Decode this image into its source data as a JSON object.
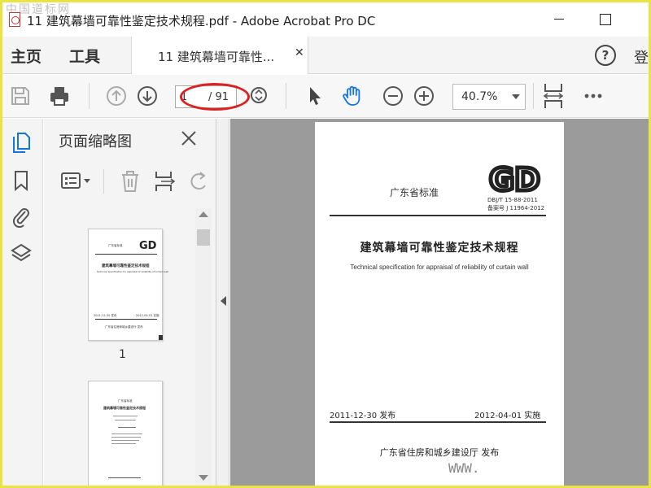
{
  "window": {
    "title": "11 建筑幕墙可靠性鉴定技术规程.pdf - Adobe Acrobat Pro DC",
    "watermark": "中国道标网"
  },
  "menu": {
    "home": "主页",
    "tools": "工具",
    "doc_tab": "11 建筑幕墙可靠性...",
    "login": "登"
  },
  "toolbar": {
    "page_current": "1",
    "page_total": "/ 91",
    "zoom": "40.7%"
  },
  "thumbnail_panel": {
    "title": "页面缩略图",
    "page1_number": "1",
    "thumb1": {
      "std": "广东省标准",
      "title": "建筑幕墙可靠性鉴定技术规程",
      "subtitle": "Technical specification for appraisal of reliability of curtain wall",
      "issue": "2011-12-30 发布",
      "impl": "2012-04-01 实施",
      "publisher": "广东省住房和城乡建设厅 发布"
    },
    "thumb2": {
      "std": "广东省标准",
      "title": "建筑幕墙可靠性鉴定技术规程"
    }
  },
  "document": {
    "std_label": "广东省标准",
    "logo_text": "GD",
    "std_number": "DBJ/T 15-88-2011",
    "filing_number": "备案号 J 11964-2012",
    "title": "建筑幕墙可靠性鉴定技术规程",
    "subtitle": "Technical specification for appraisal of reliability of curtain wall",
    "issue_date": "2011-12-30  发布",
    "implement_date": "2012-04-01  实施",
    "publisher": "广东省住房和城乡建设厅    发布",
    "watermark": "WWW."
  },
  "colors": {
    "window_border": "#e9e441",
    "highlight_oval": "#e02020",
    "hand_tool": "#1473e6",
    "nav_tools": "#1473e6"
  },
  "icons": {
    "toolbar": [
      "save-icon",
      "print-icon",
      "page-up-icon",
      "page-down-icon",
      "page-scroll-icon",
      "select-arrow-icon",
      "hand-tool-icon",
      "zoom-out-icon",
      "zoom-in-icon",
      "fit-page-icon",
      "more-icon"
    ],
    "rail": [
      "page-thumbnails-icon",
      "bookmarks-icon",
      "attachments-icon",
      "layers-icon"
    ],
    "panel": [
      "options-icon",
      "delete-icon",
      "extract-icon",
      "rotate-icon"
    ]
  }
}
